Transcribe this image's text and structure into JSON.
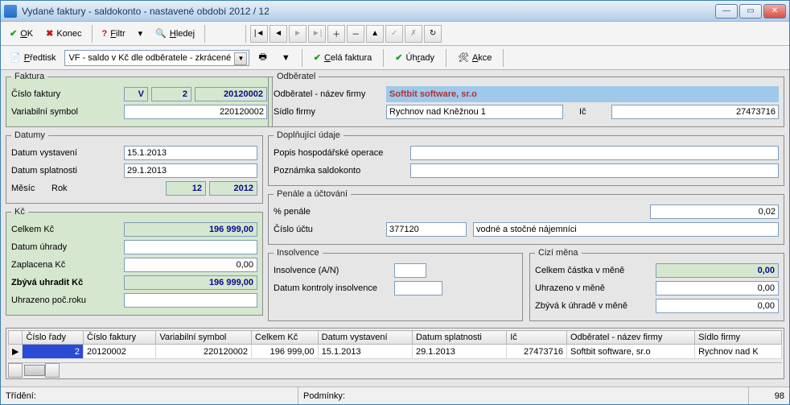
{
  "window": {
    "title": "Vydané faktury - saldokonto - nastavené období 2012 / 12"
  },
  "toolbar": {
    "ok": "OK",
    "konec": "Konec",
    "filtr": "Filtr",
    "hledej": "Hledej",
    "predtisk": "Předtisk",
    "combo_vf": "VF - saldo v Kč dle odběratele - zkrácené",
    "cela_faktura": "Celá faktura",
    "uhrady": "Úhrady",
    "akce": "Akce"
  },
  "faktura": {
    "legend": "Faktura",
    "cislo_label": "Číslo faktury",
    "vs_label": "Variabilní symbol",
    "typ": "V",
    "rada": "2",
    "cislo": "20120002",
    "vs": "220120002"
  },
  "datumy": {
    "legend": "Datumy",
    "vyst_label": "Datum vystavení",
    "splat_label": "Datum splatnosti",
    "mesic_label": "Měsíc",
    "rok_label": "Rok",
    "vyst": "15.1.2013",
    "splat": "29.1.2013",
    "mesic": "12",
    "rok": "2012"
  },
  "kc": {
    "legend": "Kč",
    "celkem_label": "Celkem Kč",
    "uhr_label": "Datum úhrady",
    "zapl_label": "Zaplacena Kč",
    "zbyva_label": "Zbývá uhradit Kč",
    "uhrpoc_label": "Uhrazeno poč.roku",
    "celkem": "196 999,00",
    "uhr": "",
    "zapl": "0,00",
    "zbyva": "196 999,00",
    "uhrpoc": ""
  },
  "odberatel": {
    "legend": "Odběratel",
    "nazev_label": "Odběratel - název firmy",
    "sidlo_label": "Sídlo firmy",
    "ic_label": "Ič",
    "nazev": "Softbit software, sr.o",
    "sidlo": "Rychnov nad Kněžnou 1",
    "ic": "27473716"
  },
  "dopln": {
    "legend": "Doplňující údaje",
    "popis_label": "Popis hospodářské operace",
    "pozn_label": "Poznámka saldokonto",
    "popis": "",
    "pozn": ""
  },
  "penale": {
    "legend": "Penále a účtování",
    "pct_label": "% penále",
    "ucet_label": "Číslo účtu",
    "pct": "0,02",
    "ucet": "377120",
    "ucet_popis": "vodné a stočné nájemníci"
  },
  "insolvence": {
    "legend": "Insolvence",
    "an_label": "Insolvence (A/N)",
    "datum_label": "Datum kontroly insolvence",
    "an": "",
    "datum": ""
  },
  "mena": {
    "legend": "Cizí měna",
    "celkem_label": "Celkem částka v měně",
    "uhr_label": "Uhrazeno v měně",
    "zbyva_label": "Zbývá k úhradě v měně",
    "celkem": "0,00",
    "uhr": "0,00",
    "zbyva": "0,00"
  },
  "grid": {
    "headers": [
      "Číslo řady",
      "Číslo faktury",
      "Variabilní symbol",
      "Celkem Kč",
      "Datum vystavení",
      "Datum splatnosti",
      "Ič",
      "Odběratel - název firmy",
      "Sídlo firmy"
    ],
    "row": {
      "rada": "2",
      "cislo": "20120002",
      "vs": "220120002",
      "celkem": "196 999,00",
      "vyst": "15.1.2013",
      "splat": "29.1.2013",
      "ic": "27473716",
      "nazev": "Softbit software, sr.o",
      "sidlo": "Rychnov nad K"
    }
  },
  "status": {
    "trideni_label": "Třídění:",
    "podminky_label": "Podmínky:",
    "count": "98"
  }
}
